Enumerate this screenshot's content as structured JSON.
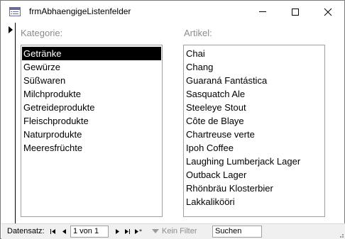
{
  "window": {
    "title": "frmAbhaengigeListenfelder",
    "icon": "form-icon",
    "controls": [
      "minimize-icon",
      "maximize-icon",
      "close-icon"
    ],
    "close_glyph": "✕"
  },
  "form": {
    "kategorie_label": "Kategorie:",
    "artikel_label": "Artikel:",
    "kategorien": [
      "Getränke",
      "Gewürze",
      "Süßwaren",
      "Milchprodukte",
      "Getreideprodukte",
      "Fleischprodukte",
      "Naturprodukte",
      "Meeresfrüchte"
    ],
    "selected_kategorie": "Getränke",
    "artikel": [
      "Chai",
      "Chang",
      "Guaraná Fantástica",
      "Sasquatch Ale",
      "Steeleye Stout",
      "Côte de Blaye",
      "Chartreuse verte",
      "Ipoh Coffee",
      "Laughing Lumberjack Lager",
      "Outback Lager",
      "Rhönbräu Klosterbier",
      "Lakkalikööri"
    ]
  },
  "navigation": {
    "label": "Datensatz:",
    "first": "⏮",
    "prev": "◀",
    "next": "▶",
    "last": "⏭",
    "new": "▶*",
    "position": "1 von 1",
    "filter_label": "Kein Filter",
    "search_placeholder": "Suchen"
  }
}
